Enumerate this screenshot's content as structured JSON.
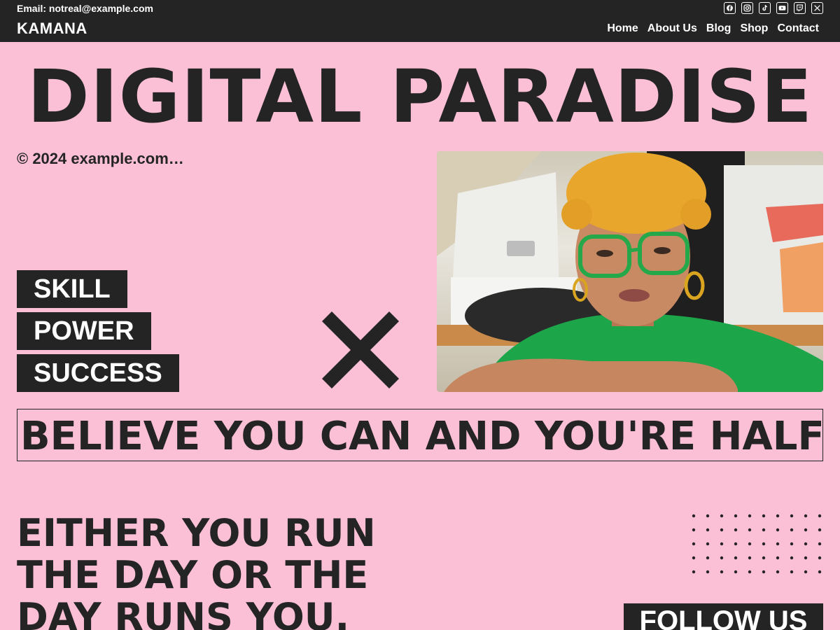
{
  "header": {
    "email": "Email: notreal@example.com",
    "brand": "KAMANA",
    "social": [
      "facebook-icon",
      "instagram-icon",
      "tiktok-icon",
      "youtube-icon",
      "twitch-icon",
      "x-icon"
    ],
    "nav": [
      {
        "label": "Home"
      },
      {
        "label": "About Us"
      },
      {
        "label": "Blog"
      },
      {
        "label": "Shop"
      },
      {
        "label": "Contact"
      }
    ]
  },
  "hero": {
    "title": "DIGITAL PARADISE",
    "copyright": "© 2024 example.com…"
  },
  "tags": [
    "SKILL",
    "POWER",
    "SUCCESS"
  ],
  "banner": "BELIEVE YOU CAN AND YOU'RE HALFWA",
  "quote": "EITHER YOU RUN THE DAY OR THE DAY RUNS YOU.",
  "follow": "FOLLOW US",
  "colors": {
    "background": "#fbc0d6",
    "dark": "#242424",
    "light": "#ffffff"
  }
}
